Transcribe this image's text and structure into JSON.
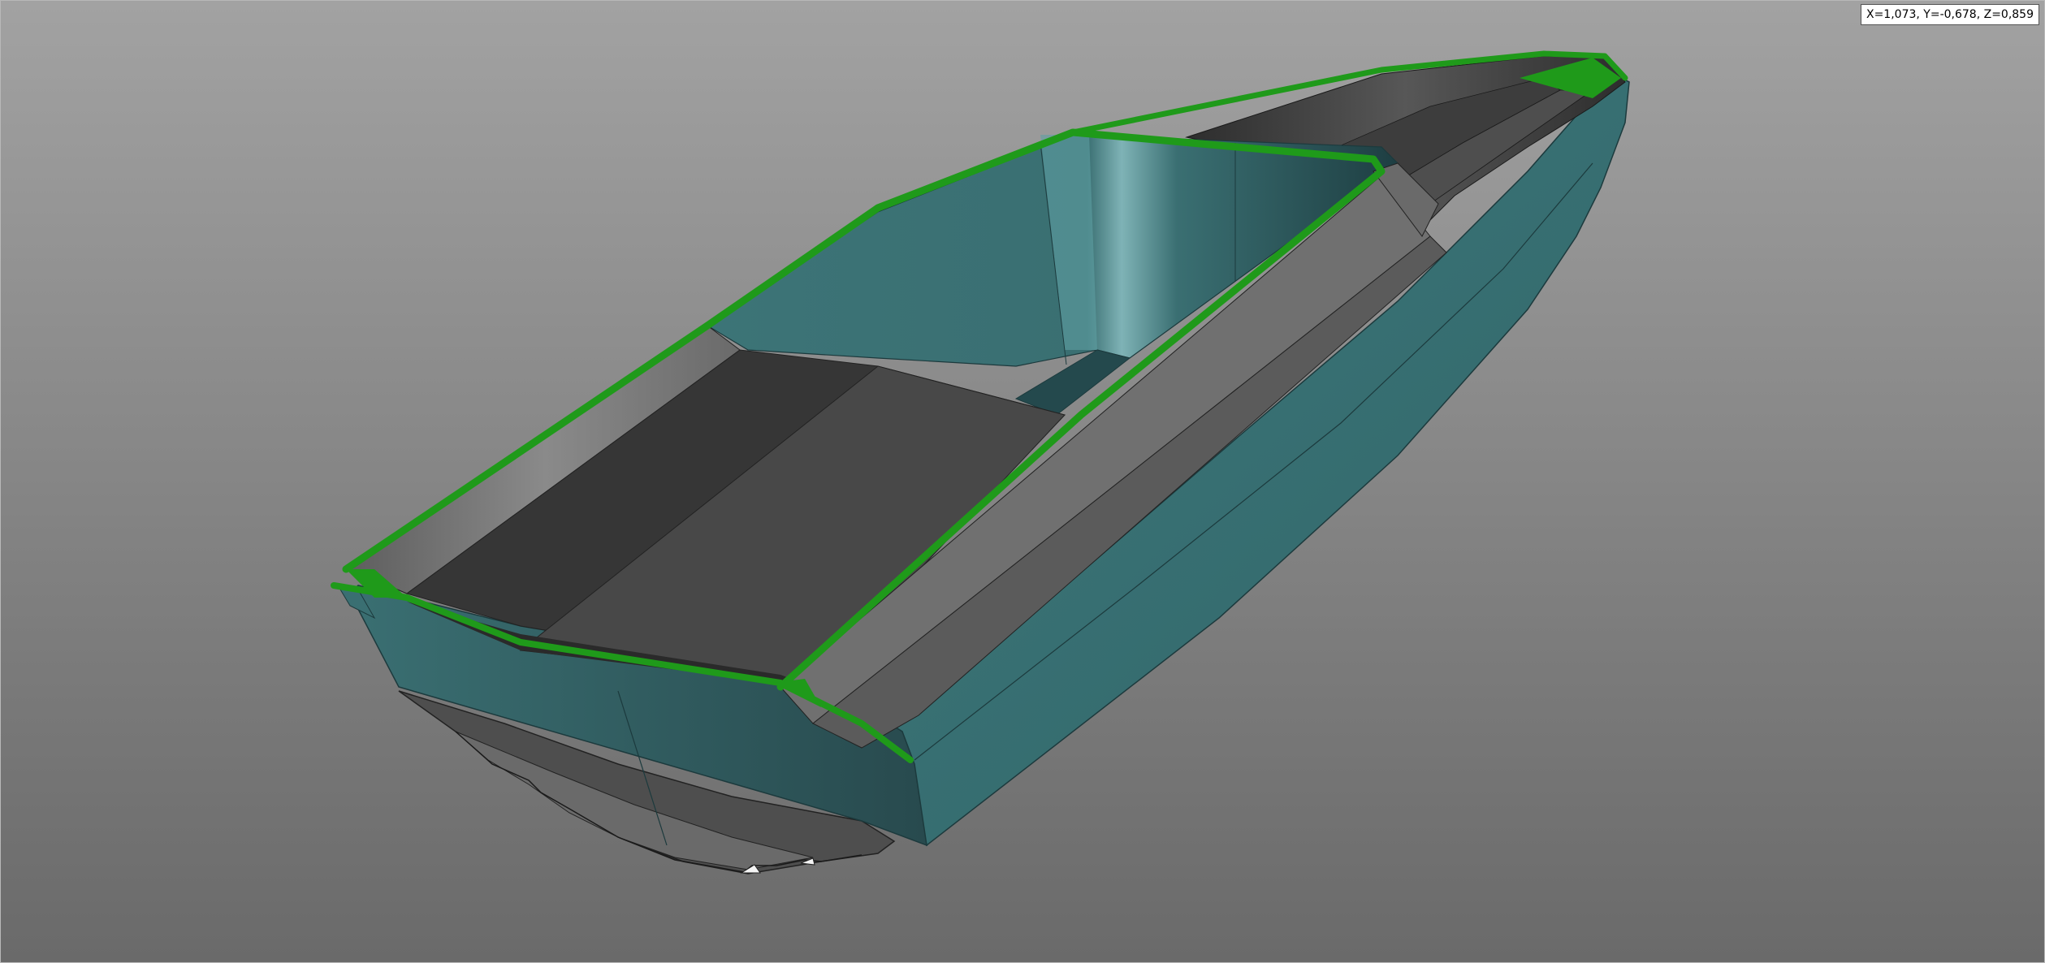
{
  "viewport": {
    "coordinate_readout": "X=1,073, Y=-0,678, Z=0,859",
    "background_colors": [
      "#a2a2a2",
      "#6a6a6a"
    ]
  },
  "model": {
    "object": "boat-hull",
    "colors": {
      "hull_side": "#3a6f72",
      "hull_dark": "#2b4c50",
      "deck_gray": "#6e6e6e",
      "deck_dark": "#333333",
      "edge_highlight": "#1f9a1a",
      "keel_underside": "#4a4a4a"
    }
  }
}
